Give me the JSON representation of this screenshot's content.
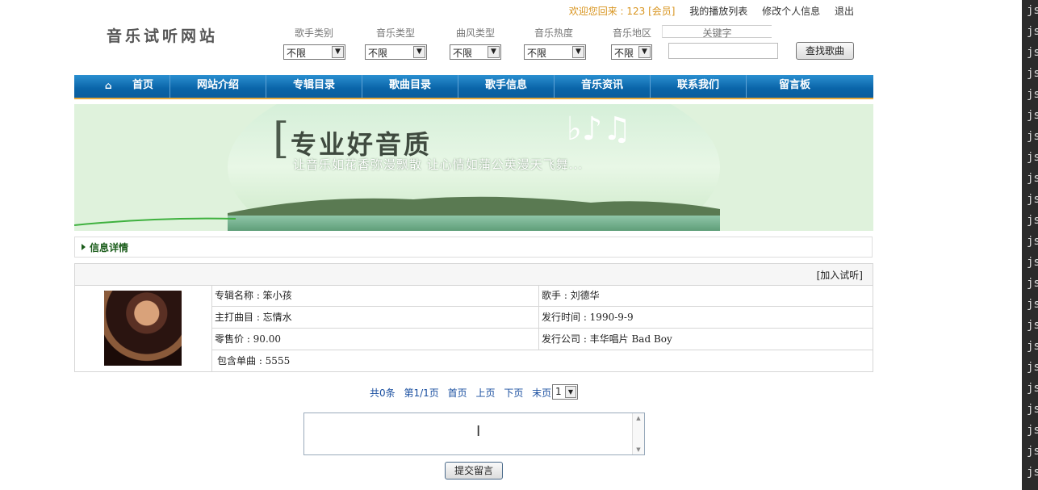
{
  "header": {
    "welcome": "欢迎您回来 : 123 [会员]",
    "links": [
      "我的播放列表",
      "修改个人信息",
      "退出"
    ],
    "logo_text": "音乐试听网站"
  },
  "filters": [
    {
      "label": "歌手类别",
      "value": "不限"
    },
    {
      "label": "音乐类型",
      "value": "不限"
    },
    {
      "label": "曲风类型",
      "value": "不限"
    },
    {
      "label": "音乐热度",
      "value": "不限"
    },
    {
      "label": "音乐地区",
      "value": "不限"
    }
  ],
  "search": {
    "keyword_label": "关键字",
    "keyword_value": "",
    "button": "查找歌曲"
  },
  "nav": [
    "首页",
    "网站介绍",
    "专辑目录",
    "歌曲目录",
    "歌手信息",
    "音乐资讯",
    "联系我们",
    "留言板"
  ],
  "banner": {
    "title": "专业好音质",
    "subtitle": "让音乐如花香弥漫飘散   让心情如蒲公英漫天飞舞..."
  },
  "info": {
    "section_title": "信息详情",
    "add_link": "[加入试听]",
    "album": "专辑名称 : 笨小孩",
    "singer": "歌手 : 刘德华",
    "main_song": "主打曲目 : 忘情水",
    "release_date": "发行时间 : 1990-9-9",
    "price": "零售价 : 90.00",
    "company": "发行公司 : 丰华唱片 Bad Boy",
    "songs": "包含单曲 : 5555"
  },
  "pager": {
    "total": "共0条",
    "page": "第1/1页",
    "first": "首页",
    "prev": "上页",
    "next": "下页",
    "last": "末页",
    "select": "1"
  },
  "comment": {
    "placeholder": "",
    "submit": "提交留言"
  },
  "side_strip": [
    "js",
    "js",
    "js",
    "js",
    "js",
    "js",
    "js",
    "js",
    "js",
    "js",
    "js",
    "js",
    "js",
    "js",
    "js",
    "js",
    "js",
    "js",
    "js",
    "js",
    "js",
    "js",
    "js",
    "js"
  ]
}
